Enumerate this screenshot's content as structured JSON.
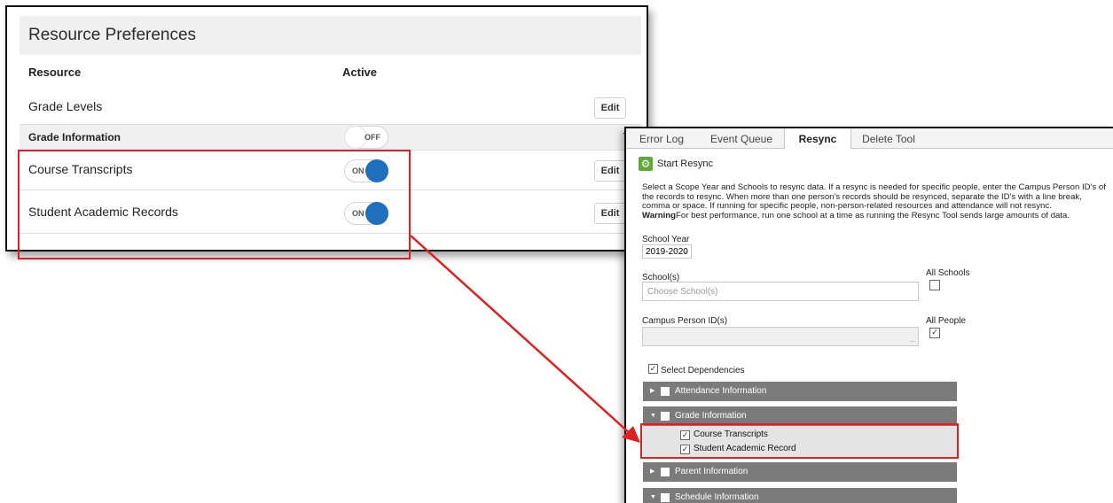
{
  "resource_preferences": {
    "title": "Resource Preferences",
    "col_resource": "Resource",
    "col_active": "Active",
    "rows": [
      {
        "label": "Grade Levels",
        "edit": "Edit"
      },
      {
        "label": "Grade Information",
        "toggle": "OFF",
        "collapse": "−"
      },
      {
        "label": "Course Transcripts",
        "toggle": "ON",
        "edit": "Edit"
      },
      {
        "label": "Student Academic Records",
        "toggle": "ON",
        "edit": "Edit"
      }
    ]
  },
  "resync": {
    "tabs": [
      "Error Log",
      "Event Queue",
      "Resync",
      "Delete Tool"
    ],
    "active_tab": "Resync",
    "start_button": "Start Resync",
    "description": "Select a Scope Year and Schools to resync data. If a resync is needed for specific people, enter the Campus Person ID's of the records to resync. When more than one person's records should be resynced, separate the ID's with a line break, comma or space. If running for specific people, non-person-related resources and attendance will not resync.",
    "warning_label": "Warning",
    "warning_text": "For best performance, run one school at a time as running the Resync Tool sends large amounts of data.",
    "school_year_label": "School Year",
    "school_year_value": "2019-2020",
    "schools_label": "School(s)",
    "schools_placeholder": "Choose School(s)",
    "all_schools_label": "All Schools",
    "person_id_label": "Campus Person ID(s)",
    "all_people_label": "All People",
    "select_dependencies_label": "Select Dependencies",
    "dependency_groups": [
      {
        "label": "Attendance Information",
        "expanded": false
      },
      {
        "label": "Grade Information",
        "expanded": true,
        "children": [
          "Course Transcripts",
          "Student Academic Record"
        ]
      },
      {
        "label": "Parent Information",
        "expanded": false
      },
      {
        "label": "Schedule Information",
        "expanded": true
      }
    ]
  },
  "colors": {
    "highlight": "#e02020",
    "toggle_on": "#1f6fbf",
    "gear": "#5fa83a",
    "bar": "#7b7b7b"
  }
}
